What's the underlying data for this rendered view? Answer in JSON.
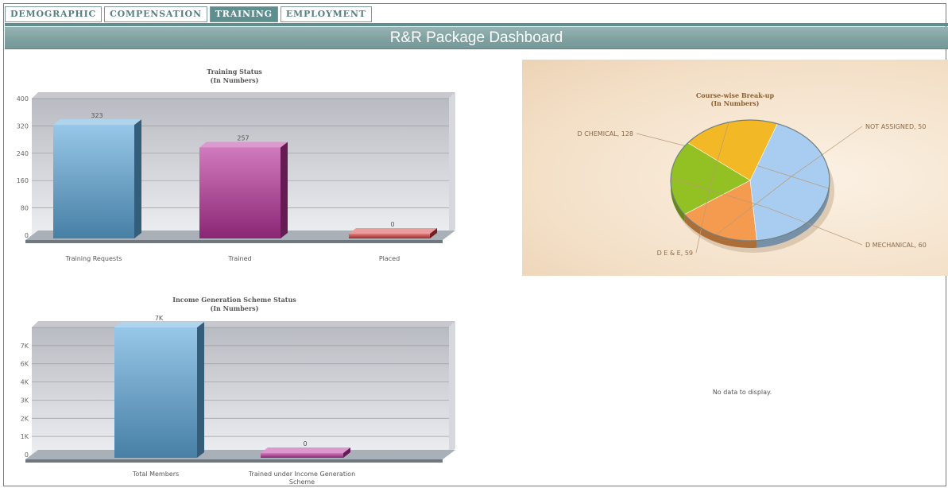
{
  "tabs": [
    {
      "label": "DEMOGRAPHIC",
      "active": false
    },
    {
      "label": "COMPENSATION",
      "active": false
    },
    {
      "label": "TRAINING",
      "active": true
    },
    {
      "label": "EMPLOYMENT",
      "active": false
    }
  ],
  "header": {
    "title": "R&R Package Dashboard"
  },
  "chart_data": [
    {
      "type": "bar",
      "title": "Training Status",
      "subtitle": "(In Numbers)",
      "categories": [
        "Training Requests",
        "Trained",
        "Placed"
      ],
      "values": [
        323,
        257,
        0
      ],
      "value_labels": [
        "323",
        "257",
        "0"
      ],
      "ylim": [
        0,
        400
      ],
      "yticks": [
        0,
        80,
        160,
        240,
        320,
        400
      ],
      "ytick_labels": [
        "0",
        "80",
        "160",
        "240",
        "320",
        "400"
      ],
      "colors": [
        "#5fa9dc",
        "#b8339a",
        "#d33a3a"
      ],
      "grid": true
    },
    {
      "type": "bar",
      "title": "Income Generation Scheme Status",
      "subtitle": "(In Numbers)",
      "categories": [
        "Total Members",
        "Trained under Income Generation Scheme"
      ],
      "values": [
        7000,
        0
      ],
      "value_labels": [
        "7K",
        "0"
      ],
      "ylim": [
        0,
        7000
      ],
      "yticks": [
        0,
        1000,
        2000,
        3000,
        4000,
        5000,
        6000,
        7000
      ],
      "ytick_labels": [
        "0",
        "1K",
        "2K",
        "3K",
        "4K",
        "6K",
        "7K"
      ],
      "colors": [
        "#5fa9dc",
        "#b8339a"
      ],
      "grid": true
    },
    {
      "type": "pie",
      "title": "Course-wise Break-up",
      "subtitle": "(In Numbers)",
      "slices": [
        {
          "label": "D CHEMICAL, 128",
          "value": 128,
          "color": "#a9cdf0"
        },
        {
          "label": "NOT ASSIGNED, 50",
          "value": 50,
          "color": "#f59b4f"
        },
        {
          "label": "D MECHANICAL, 60",
          "value": 60,
          "color": "#93c022"
        },
        {
          "label": "D E & E, 59",
          "value": 59,
          "color": "#f3b825"
        }
      ]
    }
  ],
  "empty_panel": {
    "message": "No data to display."
  }
}
